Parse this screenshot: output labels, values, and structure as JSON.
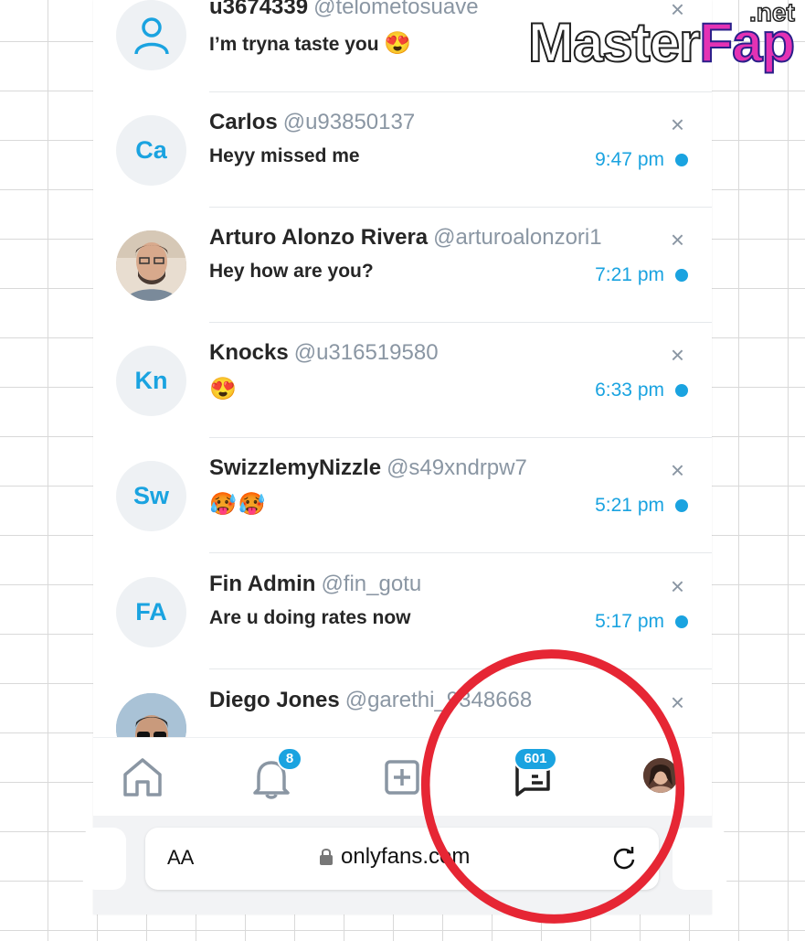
{
  "conversations": [
    {
      "name": "u3674339",
      "handle": "@telometosuave",
      "message": "I’m tryna taste you",
      "emoji": "😍",
      "time": "",
      "initials": "",
      "avatar_type": "user-icon",
      "unread": true
    },
    {
      "name": "Carlos",
      "handle": "@u93850137",
      "message": "Heyy missed me",
      "emoji": "",
      "time": "9:47 pm",
      "initials": "Ca",
      "avatar_type": "initials",
      "unread": true
    },
    {
      "name": "Arturo Alonzo Rivera",
      "handle": "@arturoalonzori1",
      "message": "Hey how are you?",
      "emoji": "",
      "time": "7:21 pm",
      "initials": "",
      "avatar_type": "photo",
      "unread": true
    },
    {
      "name": "Knocks",
      "handle": "@u316519580",
      "message": "",
      "emoji": "😍",
      "time": "6:33 pm",
      "initials": "Kn",
      "avatar_type": "initials",
      "unread": true
    },
    {
      "name": "SwizzlemyNizzle",
      "handle": "@s49xndrpw7",
      "message": "",
      "emoji": "🥵🥵",
      "time": "5:21 pm",
      "initials": "Sw",
      "avatar_type": "initials",
      "unread": true
    },
    {
      "name": "Fin Admin",
      "handle": "@fin_gotu",
      "message": "Are u doing rates now",
      "emoji": "",
      "time": "5:17 pm",
      "initials": "FA",
      "avatar_type": "initials",
      "unread": true
    },
    {
      "name": "Diego Jones",
      "handle": "@garethi_9348668",
      "message": "",
      "emoji": "",
      "time": "",
      "initials": "",
      "avatar_type": "photo",
      "unread": false
    }
  ],
  "close_glyph": "×",
  "nav": {
    "home_icon": "home-icon",
    "notifications_icon": "bell-icon",
    "notifications_badge": "8",
    "add_icon": "plus-square-icon",
    "messages_icon": "chat-icon",
    "messages_badge": "601",
    "profile_icon": "avatar"
  },
  "browser": {
    "text_size_label": "AA",
    "url": "onlyfans.com",
    "lock_icon": "lock-icon",
    "reload_icon": "reload-icon"
  },
  "watermark": {
    "part1": "Master",
    "part2": "Fap",
    "part3": ".net"
  },
  "colors": {
    "accent": "#1aa3e0",
    "annotation_circle": "#e62634",
    "watermark_pink": "#e432b4"
  }
}
